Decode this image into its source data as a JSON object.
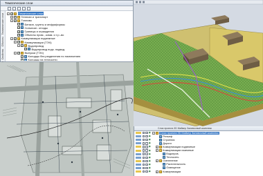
{
  "tree_panel": {
    "title": "Тематические слои",
    "side_tabs": [
      "Тематические слои",
      "Объекты",
      "Свойства",
      "Данные"
    ],
    "items": [
      {
        "label": "Тематические слои",
        "level": 0,
        "expander": "−",
        "checked": true,
        "icon": "folder",
        "selected": true
      },
      {
        "label": "Генплан и транспорт",
        "level": 1,
        "expander": "+",
        "checked": true,
        "icon": "folder"
      },
      {
        "label": "Топливо",
        "level": 1,
        "expander": "−",
        "checked": true,
        "icon": "folder"
      },
      {
        "label": "Бензин, грунты и инфраформы",
        "level": 2,
        "expander": "",
        "checked": true,
        "icon": "layer"
      },
      {
        "label": "Сильнозн. отходы",
        "level": 2,
        "expander": "",
        "checked": true,
        "icon": "layer"
      },
      {
        "label": "Границы и ограждения",
        "level": 2,
        "expander": "",
        "checked": true,
        "icon": "layer"
      },
      {
        "label": "Объекты прим., комм. и т.р.-во",
        "level": 2,
        "expander": "",
        "checked": true,
        "icon": "layer"
      },
      {
        "label": "Коммуникации подземные",
        "level": 1,
        "expander": "−",
        "checked": true,
        "icon": "folder"
      },
      {
        "label": "Коммуникации (ТЭЧ)",
        "level": 2,
        "expander": "−",
        "checked": true,
        "icon": "folder"
      },
      {
        "label": "Водопровод",
        "level": 3,
        "expander": "−",
        "checked": true,
        "icon": "folder"
      },
      {
        "label": "Водопровод подз. подвод.",
        "level": 4,
        "expander": "",
        "checked": true,
        "icon": "layer"
      },
      {
        "label": "Выпуски (ТЭЧ)",
        "level": 2,
        "expander": "−",
        "checked": true,
        "icon": "folder"
      },
      {
        "label": "Колодцы без разделения по назначению",
        "level": 3,
        "expander": "",
        "checked": true,
        "icon": "layer"
      },
      {
        "label": "Колодцы на теплосети",
        "level": 3,
        "expander": "",
        "checked": true,
        "icon": "layer"
      },
      {
        "label": "Колодцы на канализации",
        "level": 3,
        "expander": "",
        "checked": true,
        "icon": "layer"
      },
      {
        "label": "Колодцы на водопроводе",
        "level": 3,
        "expander": "",
        "checked": true,
        "icon": "layer"
      },
      {
        "label": "Коммуникации наземные",
        "level": 1,
        "expander": "+",
        "checked": true,
        "icon": "folder"
      }
    ]
  },
  "layers_panel": {
    "header": [
      "",
      "",
      "Слои проекта 3D Майкер   Заливочный комплекс"
    ],
    "rows": [
      {
        "label": "Слои проекта 3D Майкер   Заливочный комплекс",
        "level": 0,
        "expander": "−",
        "selected": true,
        "swatch": "#e7c64e",
        "icon": "folder"
      },
      {
        "label": "Рельеф",
        "level": 1,
        "expander": "",
        "selected": false,
        "swatch": "#7aa1cf",
        "icon": "layer"
      },
      {
        "label": "Строения",
        "level": 1,
        "expander": "",
        "selected": false,
        "swatch": "#7aa1cf",
        "icon": "layer"
      },
      {
        "label": "Дороги",
        "level": 1,
        "expander": "",
        "selected": false,
        "swatch": "#7aa1cf",
        "icon": "layer"
      },
      {
        "label": "Коммуникации подземные",
        "level": 1,
        "expander": "+",
        "selected": false,
        "swatch": "#e7c64e",
        "icon": "folder"
      },
      {
        "label": "Коммуникации наземные",
        "level": 1,
        "expander": "+",
        "selected": false,
        "swatch": "#e7c64e",
        "icon": "folder"
      },
      {
        "label": "Водопров.",
        "level": 2,
        "expander": "",
        "selected": false,
        "swatch": "#7aa1cf",
        "icon": "layer"
      },
      {
        "label": "Теплосеть",
        "level": 2,
        "expander": "",
        "selected": false,
        "swatch": "#7aa1cf",
        "icon": "layer"
      },
      {
        "label": "Озеленение",
        "level": 1,
        "expander": "+",
        "selected": false,
        "swatch": "#e7c64e",
        "icon": "folder"
      },
      {
        "label": "Растительность",
        "level": 2,
        "expander": "",
        "selected": false,
        "swatch": "#7aa1cf",
        "icon": "layer"
      },
      {
        "label": "Освещение",
        "level": 2,
        "expander": "",
        "selected": false,
        "swatch": "#7aa1cf",
        "icon": "layer"
      },
      {
        "label": "Коммуникации",
        "level": 1,
        "expander": "+",
        "selected": false,
        "swatch": "#e7c64e",
        "icon": "folder"
      }
    ]
  },
  "colors": {
    "selection": "#3878c4",
    "plan_background": "#c9cfcc",
    "terrain_green": "#6dab4c",
    "building_roof": "#7b6a52",
    "ground_yellow": "#d9c86a"
  }
}
